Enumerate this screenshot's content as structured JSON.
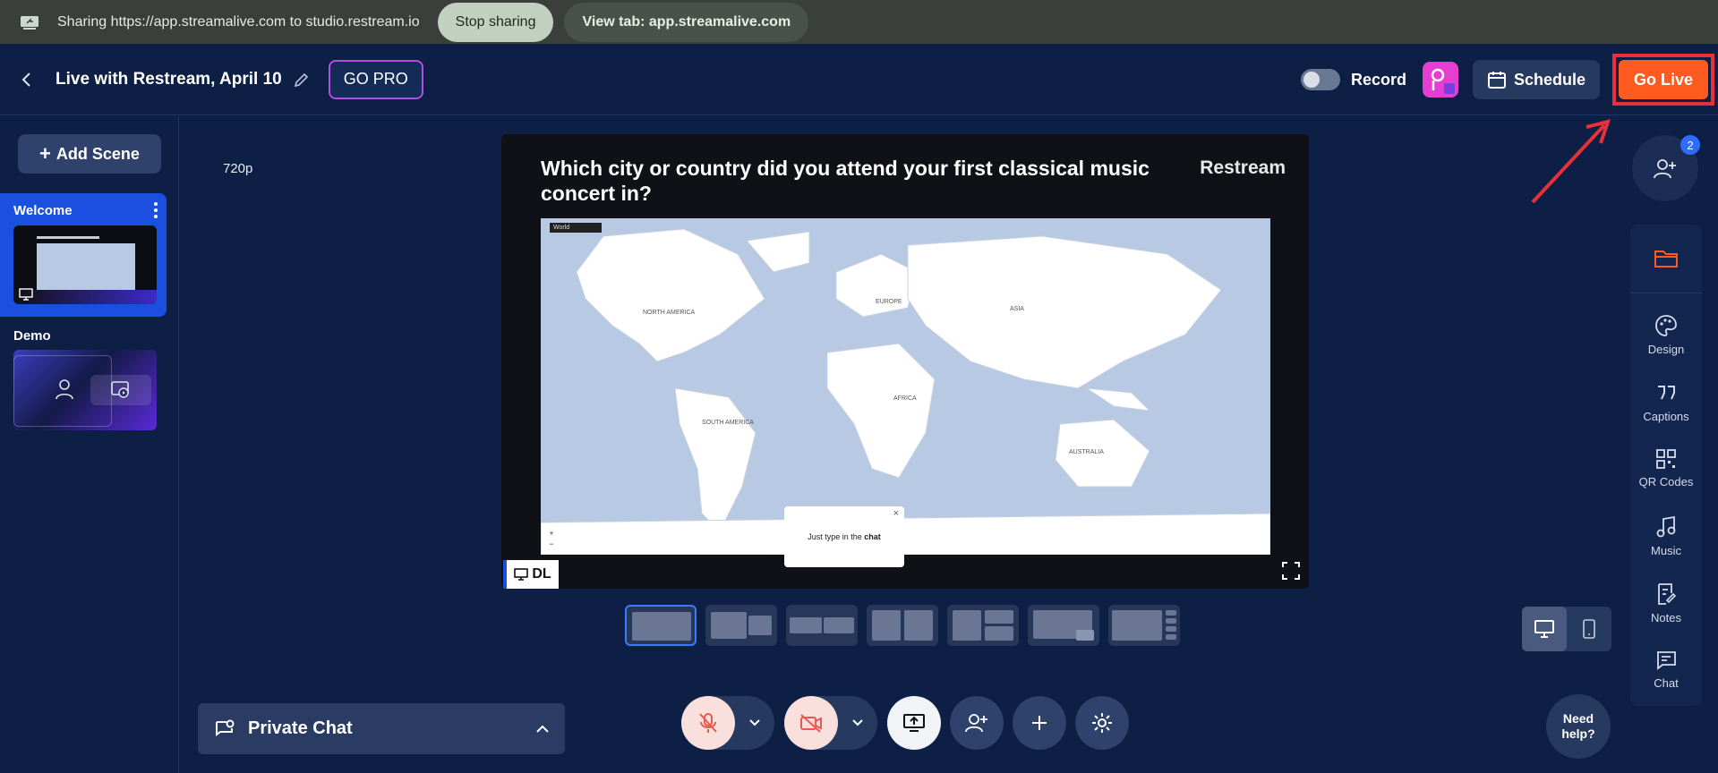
{
  "sharebar": {
    "text": "Sharing https://app.streamalive.com to studio.restream.io",
    "stop_label": "Stop sharing",
    "view_label": "View tab: app.streamalive.com"
  },
  "header": {
    "title": "Live with Restream, April 10",
    "gopro_label": "GO PRO",
    "record_label": "Record",
    "record_on": false,
    "schedule_label": "Schedule",
    "golive_label": "Go Live"
  },
  "scenes": {
    "add_label": "Add Scene",
    "items": [
      {
        "name": "Welcome",
        "active": true
      },
      {
        "name": "Demo",
        "active": false
      }
    ]
  },
  "stage": {
    "resolution": "720p",
    "question": "Which city or country did you attend your first classical music concert in?",
    "brand": "Restream",
    "popup_text_pre": "Just type in the ",
    "popup_text_bold": "chat",
    "popup_close": "×",
    "source_tag": "DL",
    "map_labels": {
      "world_select": "World",
      "north_america": "NORTH AMERICA",
      "south_america": "SOUTH AMERICA",
      "europe": "EUROPE",
      "asia": "ASIA",
      "africa": "AFRICA",
      "australia": "AUSTRALIA",
      "zoom_in": "+",
      "zoom_out": "−"
    }
  },
  "bottom": {
    "private_chat_label": "Private Chat",
    "need_help": "Need help?"
  },
  "invite": {
    "count": "2"
  },
  "right_tools": [
    {
      "label": "",
      "icon": "folder-icon"
    },
    {
      "label": "Design",
      "icon": "palette-icon"
    },
    {
      "label": "Captions",
      "icon": "quote-icon"
    },
    {
      "label": "QR Codes",
      "icon": "qr-code-icon"
    },
    {
      "label": "Music",
      "icon": "music-icon"
    },
    {
      "label": "Notes",
      "icon": "notes-icon"
    },
    {
      "label": "Chat",
      "icon": "chat-icon"
    }
  ],
  "colors": {
    "background": "#0e1f45",
    "golive": "#ff5a1f",
    "active_scene": "#1a4fe0",
    "highlight": "#e8303a"
  }
}
